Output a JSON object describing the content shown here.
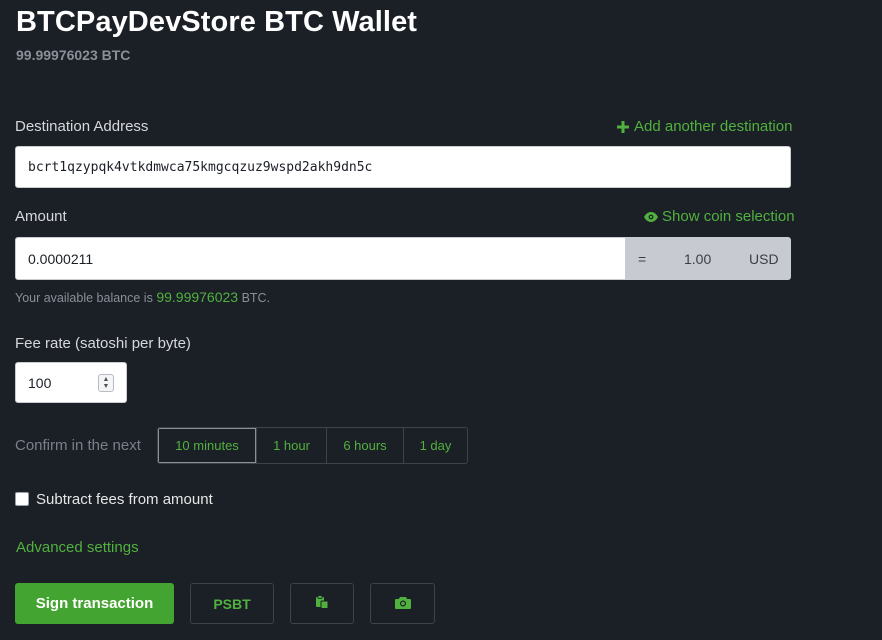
{
  "header": {
    "title": "BTCPayDevStore BTC Wallet",
    "balance": "99.99976023 BTC"
  },
  "destination": {
    "label": "Destination Address",
    "add_link": "Add another destination",
    "value": "bcrt1qzypqk4vtkdmwca75kmgcqzuz9wspd2akh9dn5c"
  },
  "amount": {
    "label": "Amount",
    "coin_link": "Show coin selection",
    "value": "0.0000211",
    "equals": "=",
    "fiat_value": "1.00",
    "fiat_currency": "USD",
    "hint_prefix": "Your available balance is",
    "hint_value": "99.99976023",
    "hint_suffix": "BTC."
  },
  "fee": {
    "label": "Fee rate (satoshi per byte)",
    "value": "100"
  },
  "confirm": {
    "label": "Confirm in the next",
    "options": [
      "10 minutes",
      "1 hour",
      "6 hours",
      "1 day"
    ],
    "selected": "10 minutes"
  },
  "subtract_fees": {
    "label": "Subtract fees from amount",
    "checked": false
  },
  "advanced": {
    "label": "Advanced settings"
  },
  "actions": {
    "sign": "Sign transaction",
    "psbt": "PSBT",
    "paste_icon": "clipboard-icon",
    "camera_icon": "camera-icon"
  },
  "colors": {
    "background": "#1b1f26",
    "accent": "#51b13e",
    "primary_button": "#44a431"
  }
}
